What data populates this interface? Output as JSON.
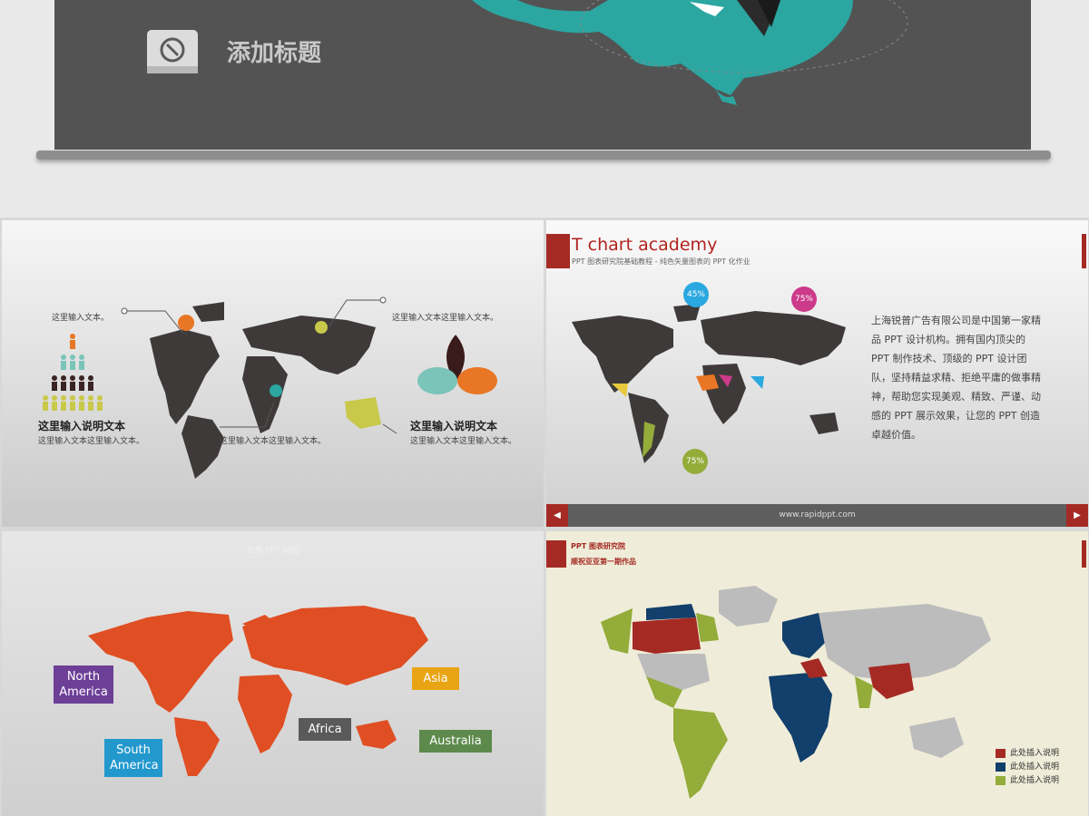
{
  "top": {
    "title": "添加标题",
    "icon": "compass-icon"
  },
  "panel1": {
    "label_top_left": "这里输入文本。",
    "label_top_right": "这里输入文本这里输入文本。",
    "heading_left": "这里输入说明文本",
    "text_left": "这里输入文本这里输入文本。",
    "text_center": "这里输入文本这里输入文本。",
    "heading_right": "这里输入说明文本",
    "text_right": "这里输入文本这里输入文本。"
  },
  "panel2": {
    "title": "T chart academy",
    "subtitle": "PPT 图表研究院基础教程 - 纯色矢量图表的 PPT 化作业",
    "body": "上海锐普广告有限公司是中国第一家精品 PPT 设计机构。拥有国内顶尖的 PPT 制作技术、顶级的 PPT 设计团队，坚持精益求精、拒绝平庸的做事精神，帮助您实现美观、精致、严谨、动感的 PPT 展示效果，让您的 PPT 创造卓越价值。",
    "bubbles": [
      "45%",
      "75%",
      "75%"
    ],
    "footer": "www.rapidppt.com",
    "prev": "◀",
    "next": "▶",
    "colors": {
      "accent": "#a52a24",
      "land": "#3e3a39"
    }
  },
  "panel3": {
    "header": "世界 PPT 地图",
    "callouts": [
      "North\nAmerica",
      "Asia",
      "Africa",
      "South\nAmerica",
      "Australia"
    ],
    "colors": {
      "land": "#e04e23"
    }
  },
  "panel4": {
    "title1": "PPT 图表研究院",
    "title2": "顺祝亚亚第一期作品",
    "legend": [
      "此处插入说明",
      "此处插入说明",
      "此处插入说明"
    ],
    "colors": {
      "red": "#a52a24",
      "navy": "#123f6b",
      "green": "#93ac3a",
      "gray": "#bcbcbc"
    }
  }
}
